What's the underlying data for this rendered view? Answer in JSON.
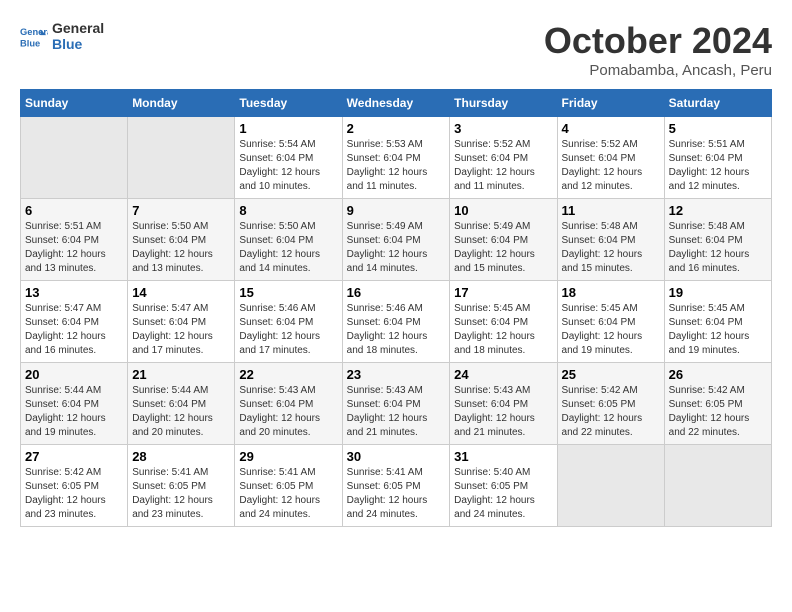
{
  "logo": {
    "line1": "General",
    "line2": "Blue"
  },
  "title": "October 2024",
  "location": "Pomabamba, Ancash, Peru",
  "weekdays": [
    "Sunday",
    "Monday",
    "Tuesday",
    "Wednesday",
    "Thursday",
    "Friday",
    "Saturday"
  ],
  "weeks": [
    [
      {
        "day": "",
        "info": ""
      },
      {
        "day": "",
        "info": ""
      },
      {
        "day": "1",
        "info": "Sunrise: 5:54 AM\nSunset: 6:04 PM\nDaylight: 12 hours\nand 10 minutes."
      },
      {
        "day": "2",
        "info": "Sunrise: 5:53 AM\nSunset: 6:04 PM\nDaylight: 12 hours\nand 11 minutes."
      },
      {
        "day": "3",
        "info": "Sunrise: 5:52 AM\nSunset: 6:04 PM\nDaylight: 12 hours\nand 11 minutes."
      },
      {
        "day": "4",
        "info": "Sunrise: 5:52 AM\nSunset: 6:04 PM\nDaylight: 12 hours\nand 12 minutes."
      },
      {
        "day": "5",
        "info": "Sunrise: 5:51 AM\nSunset: 6:04 PM\nDaylight: 12 hours\nand 12 minutes."
      }
    ],
    [
      {
        "day": "6",
        "info": "Sunrise: 5:51 AM\nSunset: 6:04 PM\nDaylight: 12 hours\nand 13 minutes."
      },
      {
        "day": "7",
        "info": "Sunrise: 5:50 AM\nSunset: 6:04 PM\nDaylight: 12 hours\nand 13 minutes."
      },
      {
        "day": "8",
        "info": "Sunrise: 5:50 AM\nSunset: 6:04 PM\nDaylight: 12 hours\nand 14 minutes."
      },
      {
        "day": "9",
        "info": "Sunrise: 5:49 AM\nSunset: 6:04 PM\nDaylight: 12 hours\nand 14 minutes."
      },
      {
        "day": "10",
        "info": "Sunrise: 5:49 AM\nSunset: 6:04 PM\nDaylight: 12 hours\nand 15 minutes."
      },
      {
        "day": "11",
        "info": "Sunrise: 5:48 AM\nSunset: 6:04 PM\nDaylight: 12 hours\nand 15 minutes."
      },
      {
        "day": "12",
        "info": "Sunrise: 5:48 AM\nSunset: 6:04 PM\nDaylight: 12 hours\nand 16 minutes."
      }
    ],
    [
      {
        "day": "13",
        "info": "Sunrise: 5:47 AM\nSunset: 6:04 PM\nDaylight: 12 hours\nand 16 minutes."
      },
      {
        "day": "14",
        "info": "Sunrise: 5:47 AM\nSunset: 6:04 PM\nDaylight: 12 hours\nand 17 minutes."
      },
      {
        "day": "15",
        "info": "Sunrise: 5:46 AM\nSunset: 6:04 PM\nDaylight: 12 hours\nand 17 minutes."
      },
      {
        "day": "16",
        "info": "Sunrise: 5:46 AM\nSunset: 6:04 PM\nDaylight: 12 hours\nand 18 minutes."
      },
      {
        "day": "17",
        "info": "Sunrise: 5:45 AM\nSunset: 6:04 PM\nDaylight: 12 hours\nand 18 minutes."
      },
      {
        "day": "18",
        "info": "Sunrise: 5:45 AM\nSunset: 6:04 PM\nDaylight: 12 hours\nand 19 minutes."
      },
      {
        "day": "19",
        "info": "Sunrise: 5:45 AM\nSunset: 6:04 PM\nDaylight: 12 hours\nand 19 minutes."
      }
    ],
    [
      {
        "day": "20",
        "info": "Sunrise: 5:44 AM\nSunset: 6:04 PM\nDaylight: 12 hours\nand 19 minutes."
      },
      {
        "day": "21",
        "info": "Sunrise: 5:44 AM\nSunset: 6:04 PM\nDaylight: 12 hours\nand 20 minutes."
      },
      {
        "day": "22",
        "info": "Sunrise: 5:43 AM\nSunset: 6:04 PM\nDaylight: 12 hours\nand 20 minutes."
      },
      {
        "day": "23",
        "info": "Sunrise: 5:43 AM\nSunset: 6:04 PM\nDaylight: 12 hours\nand 21 minutes."
      },
      {
        "day": "24",
        "info": "Sunrise: 5:43 AM\nSunset: 6:04 PM\nDaylight: 12 hours\nand 21 minutes."
      },
      {
        "day": "25",
        "info": "Sunrise: 5:42 AM\nSunset: 6:05 PM\nDaylight: 12 hours\nand 22 minutes."
      },
      {
        "day": "26",
        "info": "Sunrise: 5:42 AM\nSunset: 6:05 PM\nDaylight: 12 hours\nand 22 minutes."
      }
    ],
    [
      {
        "day": "27",
        "info": "Sunrise: 5:42 AM\nSunset: 6:05 PM\nDaylight: 12 hours\nand 23 minutes."
      },
      {
        "day": "28",
        "info": "Sunrise: 5:41 AM\nSunset: 6:05 PM\nDaylight: 12 hours\nand 23 minutes."
      },
      {
        "day": "29",
        "info": "Sunrise: 5:41 AM\nSunset: 6:05 PM\nDaylight: 12 hours\nand 24 minutes."
      },
      {
        "day": "30",
        "info": "Sunrise: 5:41 AM\nSunset: 6:05 PM\nDaylight: 12 hours\nand 24 minutes."
      },
      {
        "day": "31",
        "info": "Sunrise: 5:40 AM\nSunset: 6:05 PM\nDaylight: 12 hours\nand 24 minutes."
      },
      {
        "day": "",
        "info": ""
      },
      {
        "day": "",
        "info": ""
      }
    ]
  ]
}
